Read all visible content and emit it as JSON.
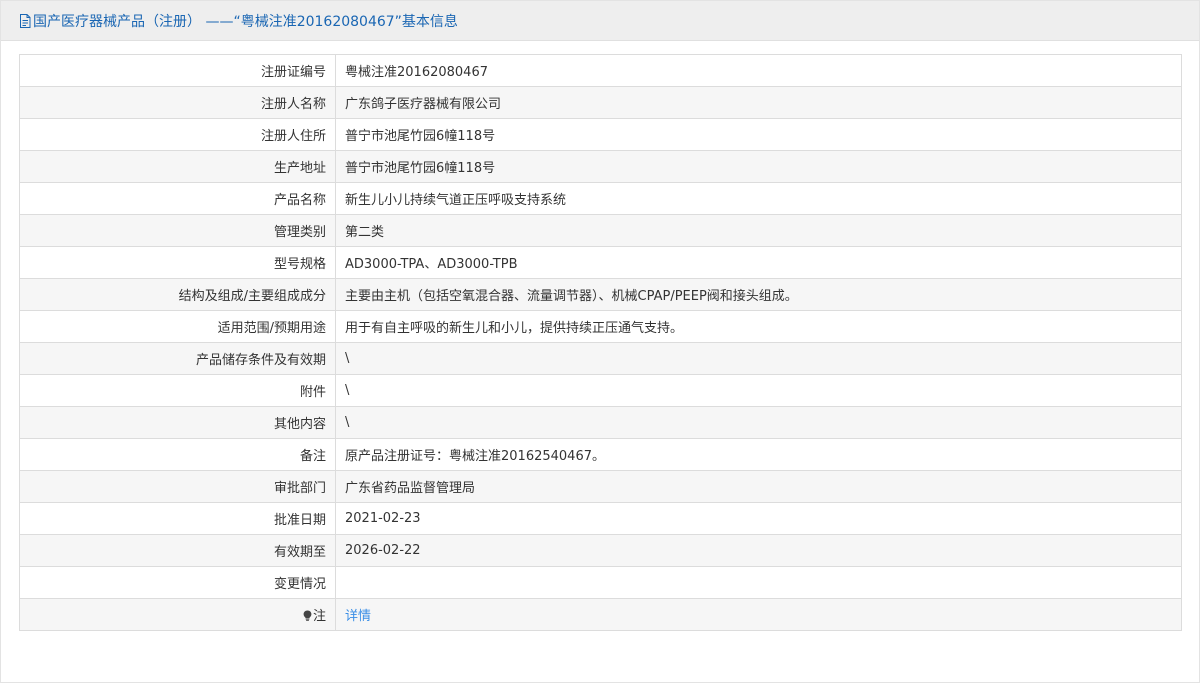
{
  "header": {
    "title": "国产医疗器械产品（注册） ——“粤械注准20162080467”基本信息"
  },
  "rows": [
    {
      "label": "注册证编号",
      "value": "粤械注准20162080467"
    },
    {
      "label": "注册人名称",
      "value": "广东鸽子医疗器械有限公司"
    },
    {
      "label": "注册人住所",
      "value": "普宁市池尾竹园6幢118号"
    },
    {
      "label": "生产地址",
      "value": "普宁市池尾竹园6幢118号"
    },
    {
      "label": "产品名称",
      "value": "新生儿小儿持续气道正压呼吸支持系统"
    },
    {
      "label": "管理类别",
      "value": "第二类"
    },
    {
      "label": "型号规格",
      "value": "AD3000-TPA、AD3000-TPB"
    },
    {
      "label": "结构及组成/主要组成成分",
      "value": "主要由主机（包括空氧混合器、流量调节器）、机械CPAP/PEEP阀和接头组成。"
    },
    {
      "label": "适用范围/预期用途",
      "value": "用于有自主呼吸的新生儿和小儿，提供持续正压通气支持。"
    },
    {
      "label": "产品储存条件及有效期",
      "value": "\\"
    },
    {
      "label": "附件",
      "value": "\\"
    },
    {
      "label": "其他内容",
      "value": "\\"
    },
    {
      "label": "备注",
      "value": "原产品注册证号：粤械注准20162540467。"
    },
    {
      "label": "审批部门",
      "value": "广东省药品监督管理局"
    },
    {
      "label": "批准日期",
      "value": "2021-02-23"
    },
    {
      "label": "有效期至",
      "value": "2026-02-22"
    },
    {
      "label": "变更情况",
      "value": ""
    }
  ],
  "note": {
    "label": "注",
    "link_text": "详情",
    "icon": "lightbulb-icon"
  },
  "colors": {
    "header_text": "#1a66b3",
    "link": "#3a8ee6",
    "header_bg": "#eeeeee",
    "row_alt_bg": "#f6f6f6",
    "border": "#dcdcdc"
  }
}
